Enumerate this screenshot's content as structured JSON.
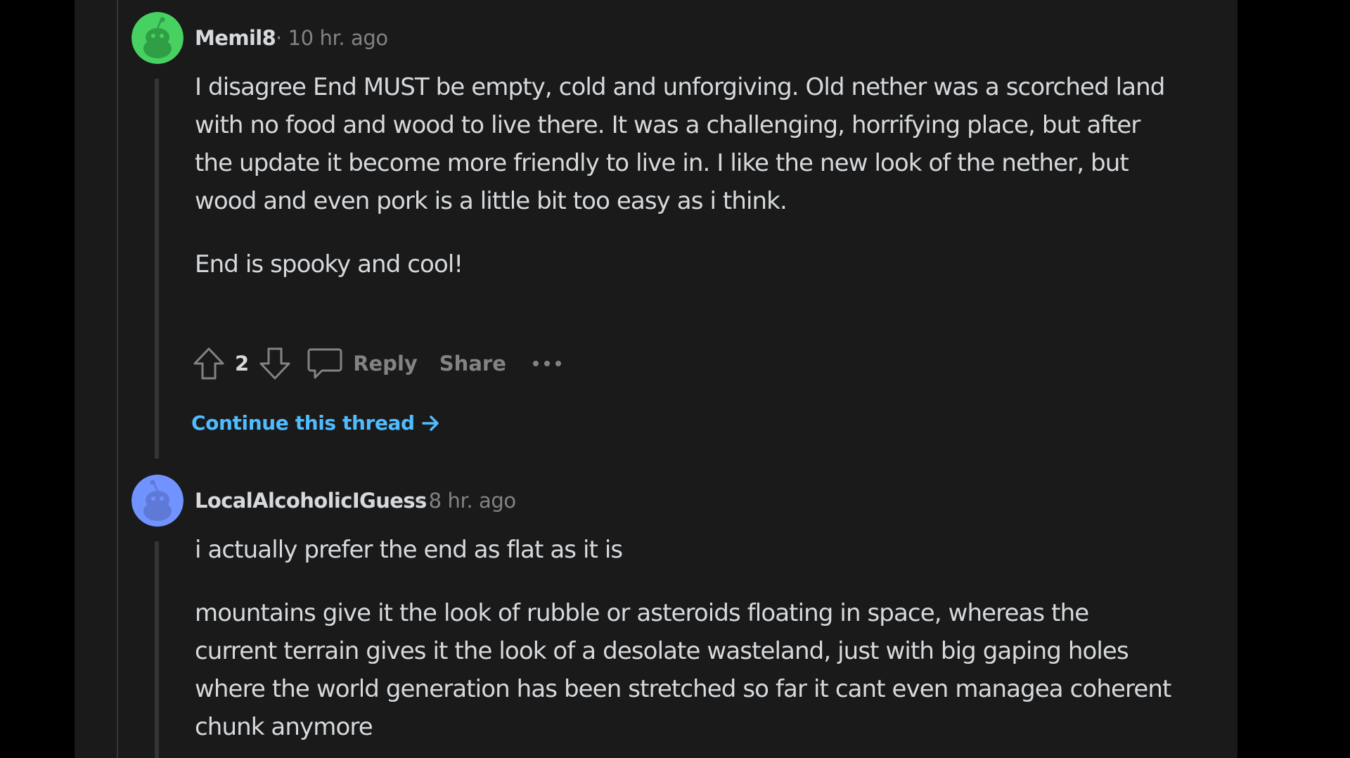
{
  "comments": [
    {
      "author": "Memil8",
      "meta": "· 10 hr. ago",
      "avatar_color": "#46d160",
      "paragraphs": [
        "I disagree End MUST be empty, cold and unforgiving. Old nether was a scorched land with no food and wood to live there. It was a challenging, horrifying place, but after the update it become more friendly to live in. I like the new look of the nether, but wood and even pork is a little bit too easy as i think.",
        "End is spooky and cool!"
      ],
      "votes": "2",
      "reply_label": "Reply",
      "share_label": "Share",
      "more_label": "•••",
      "continue_label": "Continue this thread"
    },
    {
      "author": "LocalAlcoholicIGuess",
      "meta": "· 8 hr. ago",
      "avatar_color": "#7193ff",
      "paragraphs": [
        "i actually prefer the end as flat as it is",
        "mountains give it the look of rubble or asteroids floating in space, whereas the current terrain gives it the look of a desolate wasteland, just with big gaping holes where the world generation has been stretched so far it cant even managea coherent chunk anymore"
      ]
    }
  ],
  "colors": {
    "background": "#000000",
    "panel": "#1a1a1b",
    "text": "#d7dadc",
    "muted": "#818384",
    "link": "#4fbcff",
    "thread_line": "#343536"
  },
  "icons": {
    "upvote": "upvote-arrow-icon",
    "downvote": "downvote-arrow-icon",
    "reply": "comment-bubble-icon",
    "more": "more-options-icon",
    "continue": "arrow-right-icon",
    "avatar": "snoo-avatar-icon"
  }
}
